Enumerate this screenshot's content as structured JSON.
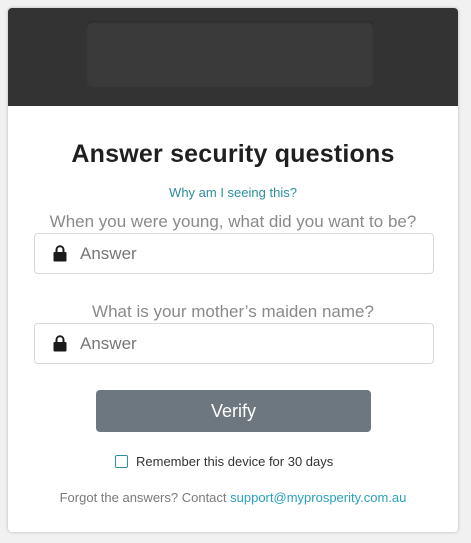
{
  "header": {
    "logo": "brand-logo"
  },
  "title": "Answer security questions",
  "why_link": "Why am I seeing this?",
  "questions": [
    {
      "label": "When you were young, what did you want to be?",
      "placeholder": "Answer",
      "value": ""
    },
    {
      "label": "What is your mother’s maiden name?",
      "placeholder": "Answer",
      "value": ""
    }
  ],
  "verify_label": "Verify",
  "remember": {
    "label": "Remember this device for 30 days",
    "checked": false
  },
  "forgot": {
    "text": "Forgot the answers? Contact ",
    "link": "support@myprosperity.com.au"
  },
  "colors": {
    "accent": "#2c8f9d",
    "button": "#6c7780",
    "header": "#333333"
  },
  "icons": {
    "field": "lock-icon"
  }
}
